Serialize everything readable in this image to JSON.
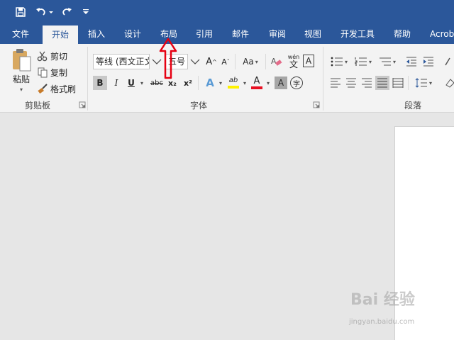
{
  "quick_access": {
    "save_icon": "save-icon",
    "undo_icon": "undo-icon",
    "redo_icon": "redo-icon",
    "customize_icon": "customize-qat-icon"
  },
  "tabs": [
    {
      "label": "文件"
    },
    {
      "label": "开始"
    },
    {
      "label": "插入"
    },
    {
      "label": "设计"
    },
    {
      "label": "布局"
    },
    {
      "label": "引用"
    },
    {
      "label": "邮件"
    },
    {
      "label": "审阅"
    },
    {
      "label": "视图"
    },
    {
      "label": "开发工具"
    },
    {
      "label": "帮助"
    },
    {
      "label": "Acrob"
    }
  ],
  "active_tab": "开始",
  "clipboard": {
    "paste_label": "粘贴",
    "cut_label": "剪切",
    "copy_label": "复制",
    "format_painter_label": "格式刷",
    "group_label": "剪贴板"
  },
  "font": {
    "font_name": "等线 (西文正文",
    "font_size": "五号",
    "change_case": "Aa",
    "phonetic_top": "wén",
    "phonetic_bottom": "文",
    "char_border": "A",
    "bold": "B",
    "italic": "I",
    "underline": "U",
    "strike": "abc",
    "subscript": "x₂",
    "superscript": "x²",
    "effects": "A",
    "highlight": "ab",
    "font_color": "A",
    "char_shading": "A",
    "enclose_char": "字",
    "group_label": "字体",
    "font_color_value": "#e81123",
    "highlight_color_value": "#fff200"
  },
  "paragraph": {
    "group_label": "段落"
  },
  "watermark": {
    "brand": "Bai 经验",
    "url": "jingyan.baidu.com"
  },
  "colors": {
    "accent": "#2b579a",
    "ribbon_bg": "#f3f3f3",
    "annotation_arrow": "#e60012"
  }
}
